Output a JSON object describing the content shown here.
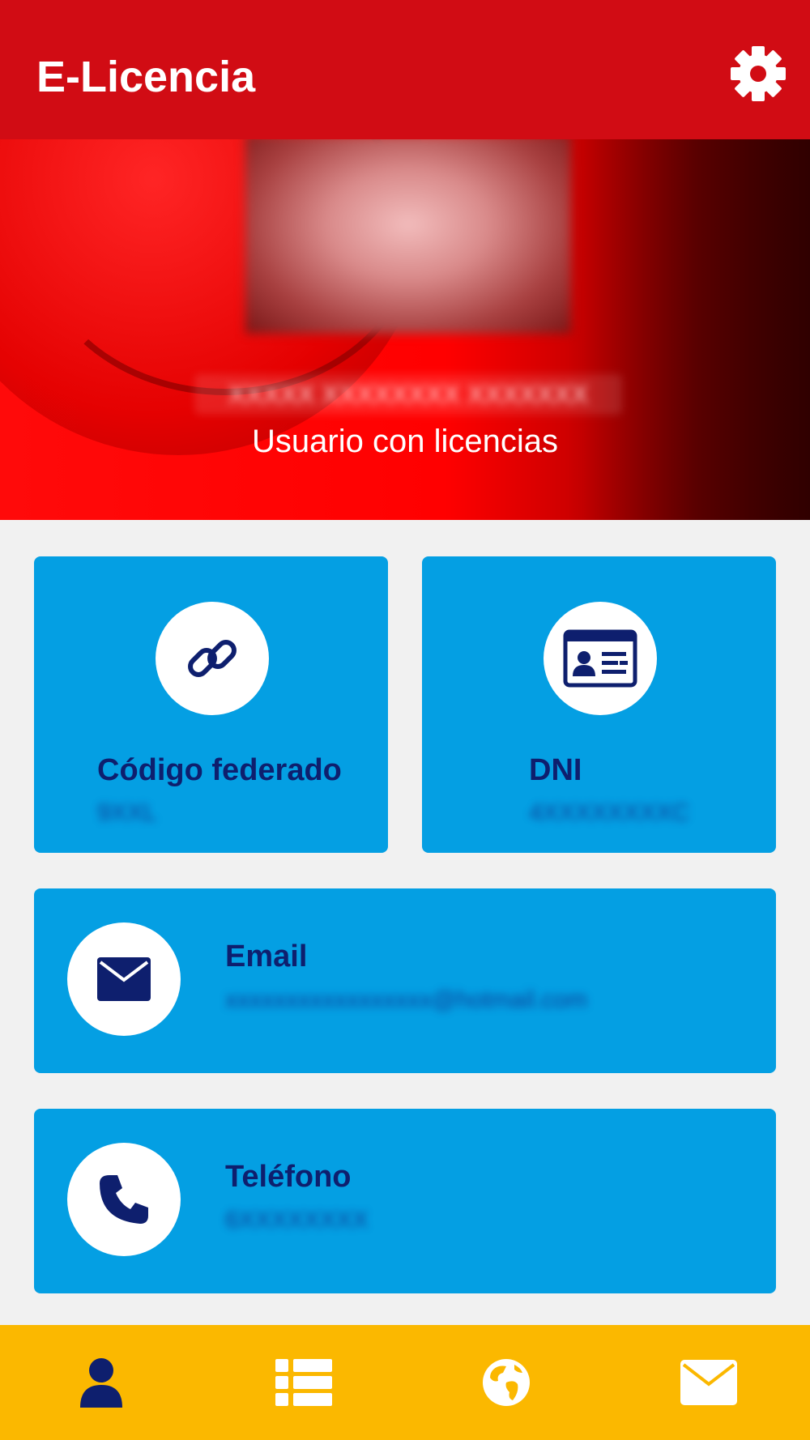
{
  "app": {
    "title": "E-Licencia"
  },
  "icons": {
    "settings": "gear-icon",
    "federated_code": "link-icon",
    "dni": "id-card-icon",
    "email": "envelope-icon",
    "phone": "phone-icon",
    "nav_profile": "user-icon",
    "nav_list": "list-icon",
    "nav_web": "globe-icon",
    "nav_messages": "mail-icon"
  },
  "profile": {
    "name": "XXXXX XXXXXXXX XXXXXXX",
    "role": "Usuario con licencias"
  },
  "cards": {
    "federated_code": {
      "label": "Código federado",
      "value": "9XXL"
    },
    "dni": {
      "label": "DNI",
      "value": "4XXXXXXXXC"
    },
    "email": {
      "label": "Email",
      "value": "xxxxxxxxxxxxxxxxx@hotmail.com"
    },
    "phone": {
      "label": "Teléfono",
      "value": "6XXXXXXXX"
    }
  },
  "colors": {
    "appbar": "#d10c14",
    "hero": "#ff0000",
    "card": "#049fe3",
    "card_text": "#0e1f6e",
    "bottom_nav": "#fbb800",
    "nav_active_icon": "#0e1f6e",
    "nav_icon": "#ffffff"
  },
  "bottom_nav": {
    "active": "profile",
    "items": [
      "profile",
      "list",
      "web",
      "messages"
    ]
  }
}
